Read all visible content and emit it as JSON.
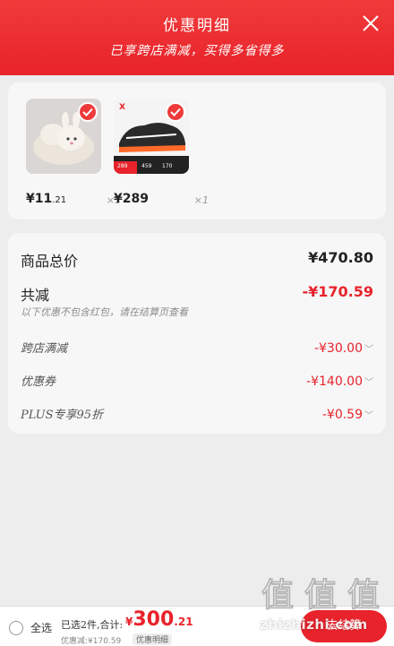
{
  "header": {
    "title": "优惠明细",
    "subtitle": "已享跨店满减，买得多省得多"
  },
  "products": [
    {
      "name": "slipper",
      "price_int": "¥11",
      "price_dec": ".21",
      "qty": "×1"
    },
    {
      "name": "sneaker",
      "price_int": "¥289",
      "price_dec": "",
      "qty": "×1"
    }
  ],
  "sneaker_tag": {
    "brand": "X",
    "values": [
      "289",
      "459",
      "170"
    ]
  },
  "summary": {
    "subtotal_label": "商品总价",
    "subtotal_value": "¥470.80",
    "total_discount_label": "共减",
    "total_discount_value": "-¥170.59",
    "note": "以下优惠不包含红包，请在结算页查看",
    "items": [
      {
        "label": "跨店满减",
        "value": "-¥30.00"
      },
      {
        "label": "优惠券",
        "value": "-¥140.00"
      },
      {
        "label": "PLUS专享95折",
        "value": "-¥0.59"
      }
    ]
  },
  "footer": {
    "select_all": "全选",
    "selected_count": "已选2件,合计:",
    "total_yen": "¥",
    "total_int": "300",
    "total_dec": ".21",
    "discount_line": "优惠减:¥170.59",
    "detail_chip": "优惠明细",
    "checkout_label": "去结算"
  },
  "watermark": {
    "logo_chars": [
      "值",
      "值",
      "值"
    ],
    "site": "zhizhizhi.com"
  },
  "colors": {
    "accent": "#e8232b",
    "background": "#ededed",
    "card": "#f7f7f7"
  },
  "icons": [
    "close-icon",
    "check-icon",
    "radio-icon",
    "chevron-down-icon"
  ]
}
